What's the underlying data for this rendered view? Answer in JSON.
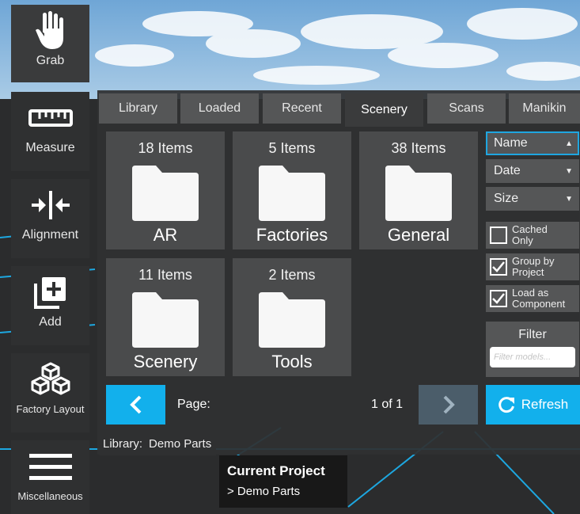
{
  "toolbar": {
    "grab": {
      "label": "Grab",
      "icon": "hand-icon"
    },
    "measure": {
      "label": "Measure",
      "icon": "ruler-icon"
    },
    "alignment": {
      "label": "Alignment",
      "icon": "alignment-icon"
    },
    "add": {
      "label": "Add",
      "icon": "add-icon"
    },
    "factory_layout": {
      "label": "Factory Layout",
      "icon": "cubes-icon"
    },
    "miscellaneous": {
      "label": "Miscellaneous",
      "icon": "menu-icon"
    }
  },
  "tabs": [
    {
      "label": "Library"
    },
    {
      "label": "Loaded"
    },
    {
      "label": "Recent"
    },
    {
      "label": "Scenery",
      "active": true
    },
    {
      "label": "Scans"
    },
    {
      "label": "Manikin"
    }
  ],
  "folders": [
    {
      "count": "18 Items",
      "name": "AR"
    },
    {
      "count": "5 Items",
      "name": "Factories"
    },
    {
      "count": "38 Items",
      "name": "General"
    },
    {
      "count": "11 Items",
      "name": "Scenery"
    },
    {
      "count": "2 Items",
      "name": "Tools"
    }
  ],
  "sort": {
    "name": {
      "label": "Name",
      "selected": true,
      "icon": "chevron-up-icon"
    },
    "date": {
      "label": "Date",
      "icon": "chevron-down-icon"
    },
    "size": {
      "label": "Size",
      "icon": "chevron-down-icon"
    }
  },
  "options": {
    "cached_only": {
      "line1": "Cached",
      "line2": "Only",
      "checked": false
    },
    "group_by_project": {
      "line1": "Group by",
      "line2": "Project",
      "checked": true
    },
    "load_as_component": {
      "line1": "Load as",
      "line2": "Component",
      "checked": true
    }
  },
  "filter": {
    "label": "Filter",
    "placeholder": "Filter models..."
  },
  "pagination": {
    "label": "Page:",
    "value": "1 of 1"
  },
  "refresh_label": "Refresh",
  "library": {
    "label": "Library:",
    "value": "Demo Parts"
  },
  "tooltip": {
    "title": "Current Project",
    "subtitle": "> Demo Parts"
  },
  "colors": {
    "accent": "#12b0ec",
    "panel": "#2f3031",
    "tile": "#4a4b4c",
    "button": "#555657"
  }
}
